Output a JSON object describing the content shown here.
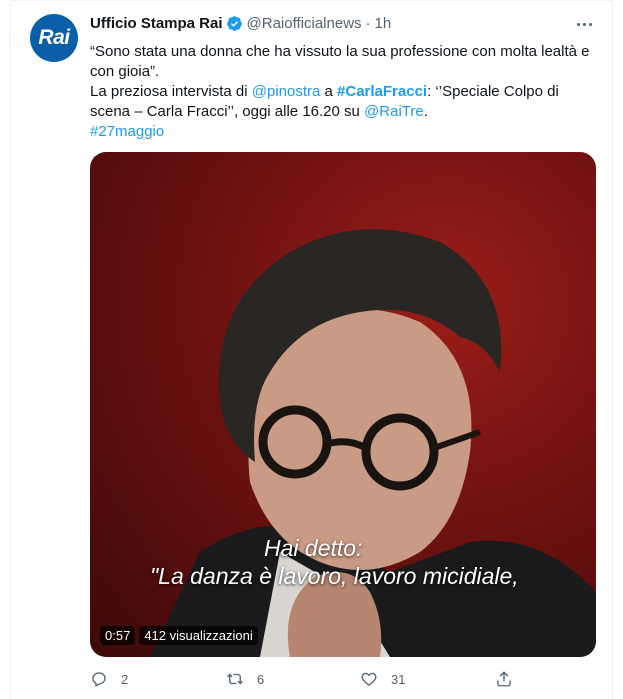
{
  "tweet": {
    "avatar_label": "Rai",
    "display_name": "Ufficio Stampa Rai",
    "handle": "@Raiofficialnews",
    "separator": "·",
    "time": "1h",
    "text": {
      "line1": "“Sono stata una donna che ha vissuto la sua professione con molta lealtà e con gioia”.",
      "line2_prefix": "La preziosa intervista di ",
      "mention1": "@pinostra",
      "line2_mid": " a ",
      "hashtag1": "#CarlaFracci",
      "line2_rest": ": ‘’Speciale Colpo di scena – Carla Fracci’’, oggi alle 16.20 su ",
      "mention2": "@RaiTre",
      "line2_end": ".",
      "hashtag2": "#27maggio"
    },
    "media": {
      "caption_line1": "Hai detto:",
      "caption_line2": "\"La danza è lavoro, lavoro micidiale,",
      "duration": "0:57",
      "views": "412 visualizzazioni"
    },
    "actions": {
      "reply_count": "2",
      "retweet_count": "6",
      "like_count": "31"
    }
  },
  "icons": [
    "more-icon",
    "verified-icon",
    "reply-icon",
    "retweet-icon",
    "like-icon",
    "share-icon"
  ],
  "colors": {
    "link": "#1d9bf0",
    "secondary_text": "#536471",
    "avatar_bg": "#0b5fa8"
  }
}
